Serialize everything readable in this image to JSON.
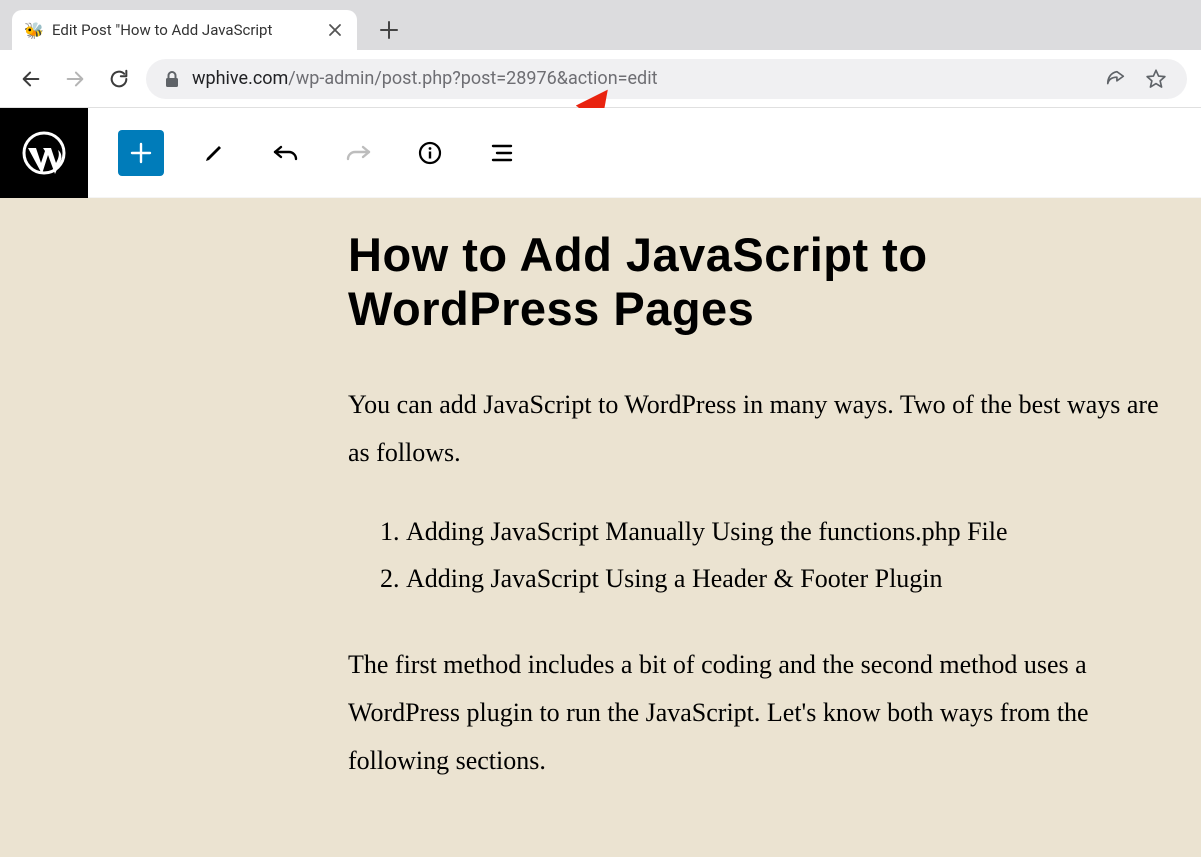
{
  "browser": {
    "tab_title": "Edit Post \"How to Add JavaScript",
    "favicon_emoji": "🐝",
    "url_domain": "wphive.com",
    "url_path": "/wp-admin/post.php?post=28976&action=edit"
  },
  "post": {
    "title": "How to Add JavaScript to WordPress Pages",
    "intro": "You can add JavaScript to WordPress in many ways. Two of the best ways are as follows.",
    "list_item_1": "Adding JavaScript Manually Using the functions.php File",
    "list_item_2": "Adding JavaScript Using a Header & Footer Plugin",
    "outro": "The first method includes a bit of coding and the second method uses a WordPress plugin to run the JavaScript. Let's know both ways from the following sections."
  }
}
